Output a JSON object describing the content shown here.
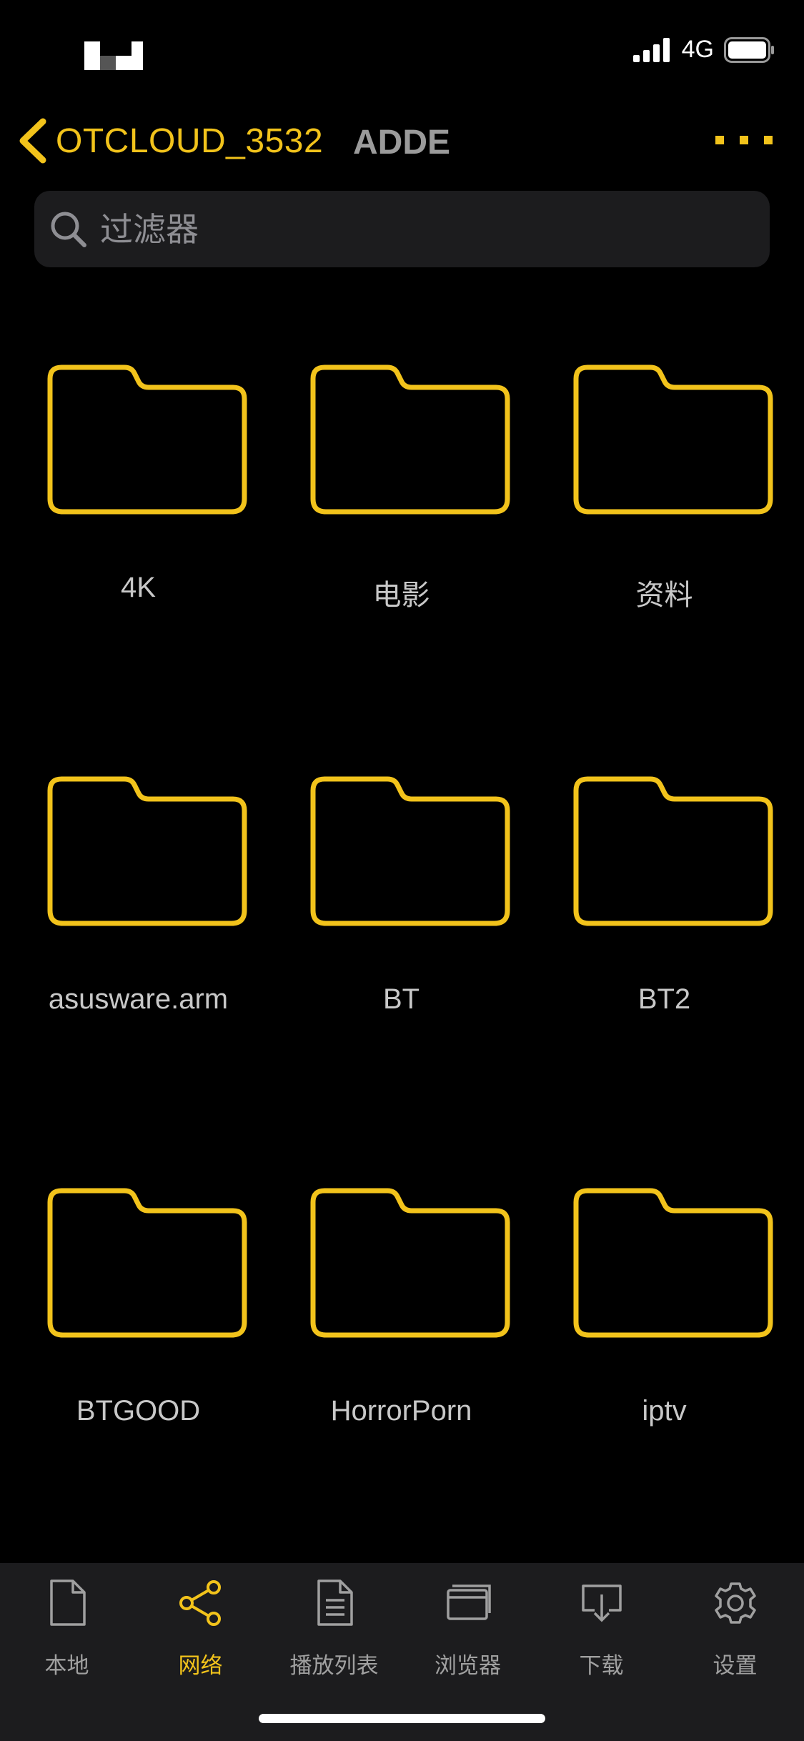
{
  "status_bar": {
    "network": "4G"
  },
  "nav": {
    "title": "OTCLOUD_3532",
    "subtitle": "ADDE"
  },
  "search": {
    "placeholder": "过滤器",
    "value": ""
  },
  "folders": [
    {
      "label": "4K"
    },
    {
      "label": "电影"
    },
    {
      "label": "资料"
    },
    {
      "label": "asusware.arm"
    },
    {
      "label": "BT"
    },
    {
      "label": "BT2"
    },
    {
      "label": "BTGOOD"
    },
    {
      "label": "HorrorPorn"
    },
    {
      "label": "iptv"
    }
  ],
  "tabs": [
    {
      "label": "本地",
      "icon": "document-icon"
    },
    {
      "label": "网络",
      "icon": "share-icon",
      "active": true
    },
    {
      "label": "播放列表",
      "icon": "list-document-icon"
    },
    {
      "label": "浏览器",
      "icon": "browser-window-icon"
    },
    {
      "label": "下载",
      "icon": "download-icon"
    },
    {
      "label": "设置",
      "icon": "gear-icon"
    }
  ],
  "colors": {
    "accent": "#F2C31B",
    "background": "#000000",
    "tabbar": "#1c1c1e",
    "inactive": "#a0a0a0"
  }
}
